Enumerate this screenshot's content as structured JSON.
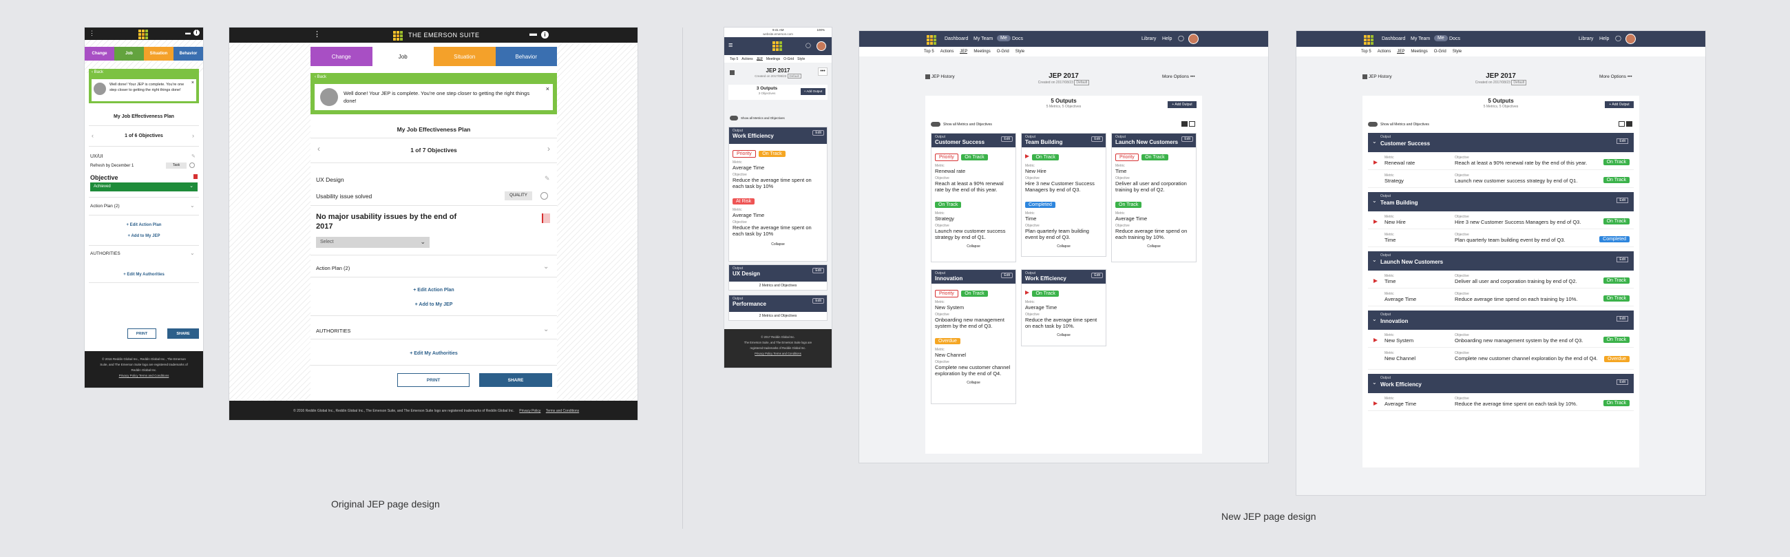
{
  "captions": {
    "left": "Original JEP page design",
    "right": "New JEP page design"
  },
  "colors": {
    "change": "#a84fc4",
    "job": "#63a33e",
    "situation": "#f4a12a",
    "behavior": "#3a6fb0",
    "navy": "#37415a",
    "green": "#3bb24a",
    "orange": "#f5a623",
    "blue": "#2e86de"
  },
  "mobile_old": {
    "tabs": [
      "Change",
      "Job",
      "Situation",
      "Behavior"
    ],
    "back": "Back",
    "notice": "Well done! Your JEP is complete. You're one step closer to getting the right things done!",
    "plan_title": "My Job Effectiveness Plan",
    "objectives_count": "1 of 6 Objectives",
    "field1": "UX/UI",
    "refresh": "Refresh by December 1",
    "refresh_badge": "Task",
    "objective_label": "Objective",
    "status": "Achieved",
    "action_plan": "Action Plan (2)",
    "edit_action": "+ Edit Action Plan",
    "add_jep": "+ Add to My JEP",
    "authorities": "AUTHORITIES",
    "edit_auth": "+ Edit My Authorities",
    "print": "PRINT",
    "share": "SHARE",
    "footer": [
      "© 2016 Reddin Global Inc., Reddin Global Inc., The Emerson",
      "Suite, and The Emerson Suite logo are registered trademarks of",
      "Reddin Global Inc.",
      "Privacy Policy   Terms and Conditions"
    ]
  },
  "desktop_old": {
    "brand": "THE EMERSON SUITE",
    "tabs": [
      "Change",
      "Job",
      "Situation",
      "Behavior"
    ],
    "back": "Back",
    "notice": "Well done! Your JEP is complete. You're one step closer to getting the right things done!",
    "plan_title": "My Job Effectiveness Plan",
    "objectives_count": "1 of 7 Objectives",
    "field1": "UX Design",
    "field2": "Usability issue solved",
    "quality": "QUALITY",
    "objective": "No major usability issues by the end of 2017",
    "select": "Select",
    "action_plan": "Action Plan (2)",
    "edit_action": "+ Edit Action Plan",
    "add_jep": "+ Add to My JEP",
    "authorities": "AUTHORITIES",
    "edit_auth": "+ Edit My Authorities",
    "print": "PRINT",
    "share": "SHARE",
    "footer": "© 2016 Reddin Global Inc., Reddin Global Inc., The Emerson Suite, and The Emerson Suite logo are registered trademarks of Reddin Global Inc.",
    "privacy": "Privacy Policy",
    "terms": "Terms and Conditions"
  },
  "mobile_new": {
    "status_time": "9:41 AM",
    "url": "website.emerson.com",
    "battery": "100%",
    "subnav": [
      "Top 5",
      "Actions",
      "JEP",
      "Meetings",
      "O-Grid",
      "Style"
    ],
    "title": "JEP 2017",
    "subtitle": "Created on 2017/08/23",
    "default": "Default",
    "outputs": "3 Outputs",
    "outputs_sub": "3 Objectives",
    "add_output": "+ Add Output",
    "toggle": "Show all Metrics and Objectives",
    "card1": {
      "kind": "Output",
      "title": "Work Efficiency",
      "edit": "Edit",
      "pills": [
        "Priority",
        "On Track"
      ],
      "m1_label": "Metric",
      "m1": "Average Time",
      "o1_label": "Objective",
      "o1": "Reduce the average time spent on each task by 10%",
      "pill2": "At Risk",
      "m2_label": "Metric",
      "m2": "Average Time",
      "o2_label": "Objective",
      "o2": "Reduce the average time spent on each task by 10%",
      "collapse": "Collapse"
    },
    "card2": {
      "kind": "Output",
      "title": "UX Design",
      "edit": "Edit",
      "more": "2 Metrics and Objectives"
    },
    "card3": {
      "kind": "Output",
      "title": "Performance",
      "edit": "Edit",
      "more": "2 Metrics and Objectives"
    },
    "footer": [
      "© 2017 Reddin Global Inc.",
      "The Emerson Suite, and The Emerson Suite logo are",
      "registered trademarks of Reddin Global Inc.",
      "Privacy Policy   Terms and Conditions"
    ]
  },
  "desktop_new_nav": {
    "items": [
      "Dashboard",
      "My Team",
      "Me",
      "Docs"
    ],
    "right": [
      "Library",
      "Help"
    ],
    "subnav": [
      "Top 5",
      "Actions",
      "JEP",
      "Meetings",
      "O-Grid",
      "Style"
    ]
  },
  "desktop_new_cards": {
    "history": "JEP History",
    "title": "JEP 2017",
    "subtitle": "Created on 2017/08/23",
    "default": "Default",
    "more": "More Options",
    "outputs": "5 Outputs",
    "outputs_sub": "5 Metrics, 5 Objectives",
    "add_output": "+ Add Output",
    "toggle": "Show all Metrics and Objectives",
    "cards": [
      {
        "kind": "Output",
        "title": "Customer Success",
        "p1": "Priority",
        "p2": "On Track",
        "m": "Renewal rate",
        "o": "Reach at least a 90% renewal rate by the end of this year.",
        "p3": "On Track",
        "m2": "Strategy",
        "o2": "Launch new customer success strategy by end of Q1.",
        "collapse": "Collapse"
      },
      {
        "kind": "Output",
        "title": "Team Building",
        "p2": "On Track",
        "m": "New Hire",
        "o": "Hire 3 new Customer Success Managers by end of Q3.",
        "p3": "Completed",
        "m2": "Time",
        "o2": "Plan quarterly team building event by end of Q3.",
        "collapse": "Collapse"
      },
      {
        "kind": "Output",
        "title": "Launch New Customers",
        "p1": "Priority",
        "p2": "On Track",
        "m": "Time",
        "o": "Deliver all user and corporation training by end of Q2.",
        "p3": "On Track",
        "m2": "Average Time",
        "o2": "Reduce average time spend on each training by 10%.",
        "collapse": "Collapse"
      },
      {
        "kind": "Output",
        "title": "Innovation",
        "p1": "Priority",
        "p2": "On Track",
        "m": "New System",
        "o": "Onboarding new management system by the end of Q3.",
        "p3": "Overdue",
        "m2": "New Channel",
        "o2": "Complete new customer channel exploration by the end of Q4.",
        "collapse": "Collapse"
      },
      {
        "kind": "Output",
        "title": "Work Efficiency",
        "p2": "On Track",
        "m": "Average Time",
        "o": "Reduce the average time spent on each task by 10%.",
        "collapse": "Collapse"
      }
    ],
    "metric_label": "Metric",
    "objective_label": "Objective",
    "edit": "Edit"
  },
  "desktop_new_list": {
    "history": "JEP History",
    "title": "JEP 2017",
    "subtitle": "Created on 2017/08/23",
    "default": "Default",
    "more": "More Options",
    "outputs": "5 Outputs",
    "outputs_sub": "5 Metrics, 5 Objectives",
    "add_output": "+ Add Output",
    "toggle": "Show all Metrics and Objectives",
    "sections": [
      {
        "title": "Customer Success",
        "rows": [
          {
            "m": "Renewal rate",
            "o": "Reach at least a 90% renewal rate by the end of this year.",
            "s": "On Track"
          },
          {
            "m": "Strategy",
            "o": "Launch new customer success strategy by end of Q1.",
            "s": "On Track"
          }
        ]
      },
      {
        "title": "Team Building",
        "rows": [
          {
            "m": "New Hire",
            "o": "Hire 3 new Customer Success Managers by end of Q3.",
            "s": "On Track"
          },
          {
            "m": "Time",
            "o": "Plan quarterly team building event by end of Q3.",
            "s": "Completed"
          }
        ]
      },
      {
        "title": "Launch New Customers",
        "rows": [
          {
            "m": "Time",
            "o": "Deliver all user and corporation training by end of Q2.",
            "s": "On Track"
          },
          {
            "m": "Average Time",
            "o": "Reduce average time spend on each training by 10%.",
            "s": "On Track"
          }
        ]
      },
      {
        "title": "Innovation",
        "rows": [
          {
            "m": "New System",
            "o": "Onboarding new management system by the end of Q3.",
            "s": "On Track"
          },
          {
            "m": "New Channel",
            "o": "Complete new customer channel exploration by the end of Q4.",
            "s": "Overdue"
          }
        ]
      },
      {
        "title": "Work Efficiency",
        "rows": [
          {
            "m": "Average Time",
            "o": "Reduce the average time spent on each task by 10%.",
            "s": "On Track"
          }
        ]
      }
    ],
    "output_label": "Output",
    "metric_label": "Metric",
    "objective_label": "Objective",
    "edit": "Edit"
  }
}
